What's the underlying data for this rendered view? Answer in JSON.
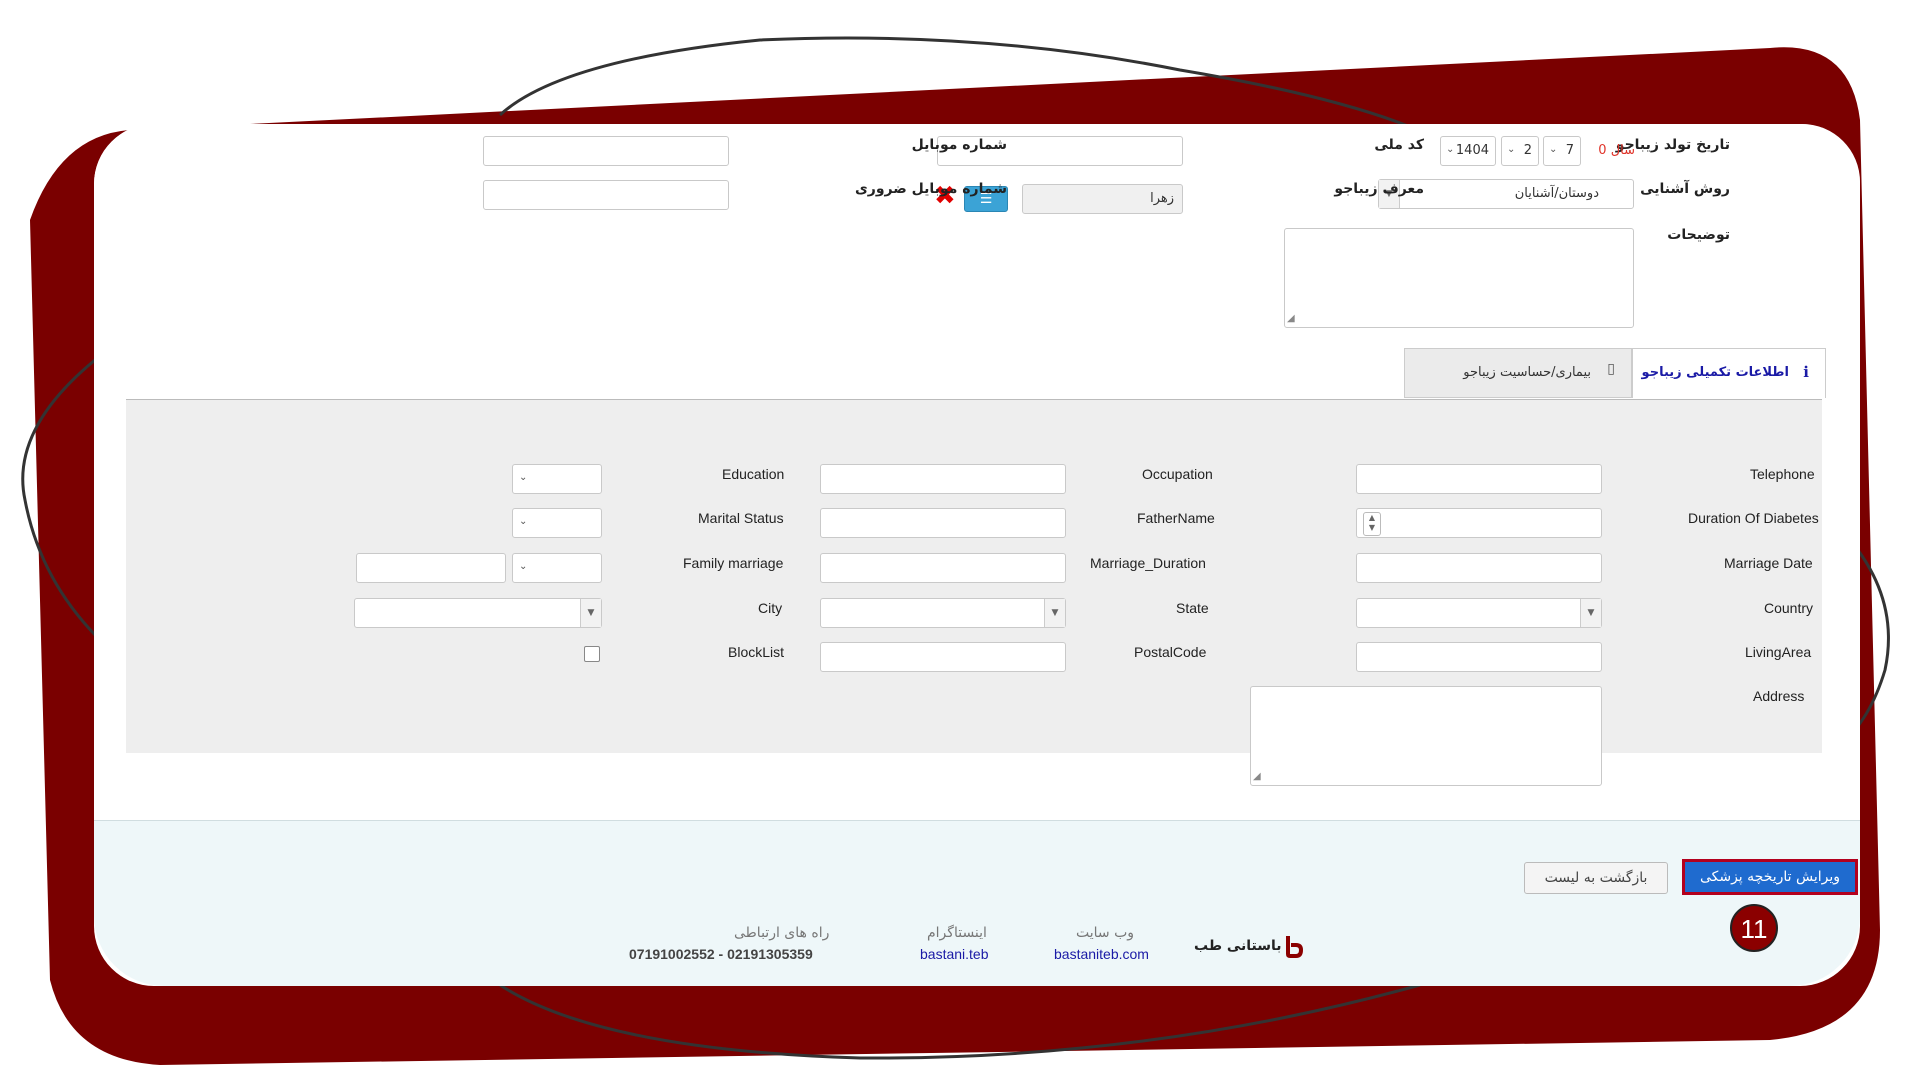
{
  "form": {
    "birth_date_label": "تاریخ تولد زیباجو",
    "age_label": "سال 0",
    "birth_day": "7",
    "birth_month": "2",
    "birth_year": "1404",
    "national_code_label": "کد ملی",
    "mobile_label": "شماره موبایل",
    "acquaintance_label": "روش آشنایی",
    "acquaintance_value": "دوستان/آشنایان",
    "referrer_label": "معرف زیباجو",
    "referrer_value": "زهرا",
    "emergency_mobile_label": "شماره موبایل ضروری",
    "description_label": "توضیحات"
  },
  "tabs": [
    {
      "label": "اطلاعات تکمیلی زیباجو",
      "icon": "info-icon",
      "active": true
    },
    {
      "label": "بیماری/حساسیت زیباجو",
      "icon": "tablet-icon",
      "active": false
    }
  ],
  "extra": {
    "telephone": "Telephone",
    "occupation": "Occupation",
    "education": "Education",
    "duration_of_diabetes": "Duration Of Diabetes",
    "father_name": "FatherName",
    "marital_status": "Marital Status",
    "marriage_date": "Marriage Date",
    "marriage_duration": "Marriage_Duration",
    "family_marriage": "Family marriage",
    "country": "Country",
    "state": "State",
    "city": "City",
    "living_area": "LivingArea",
    "postal_code": "PostalCode",
    "block_list": "BlockList",
    "address": "Address"
  },
  "buttons": {
    "edit": "ویرایش تاریخچه پزشکی",
    "back": "بازگشت به لیست"
  },
  "step_badge": "11",
  "footer": {
    "brand": "باستانی طب",
    "website_label": "وب سایت",
    "website_link": "bastaniteb.com",
    "instagram_label": "اینستاگرام",
    "instagram_link": "bastani.teb",
    "contact_label": "راه های ارتباطی",
    "phones": "07191002552 - 02191305359"
  },
  "colors": {
    "frame": "#7a0000",
    "primary_button": "#1f6bcf",
    "highlight_border": "#b3001e",
    "age_text": "#e0352b"
  }
}
